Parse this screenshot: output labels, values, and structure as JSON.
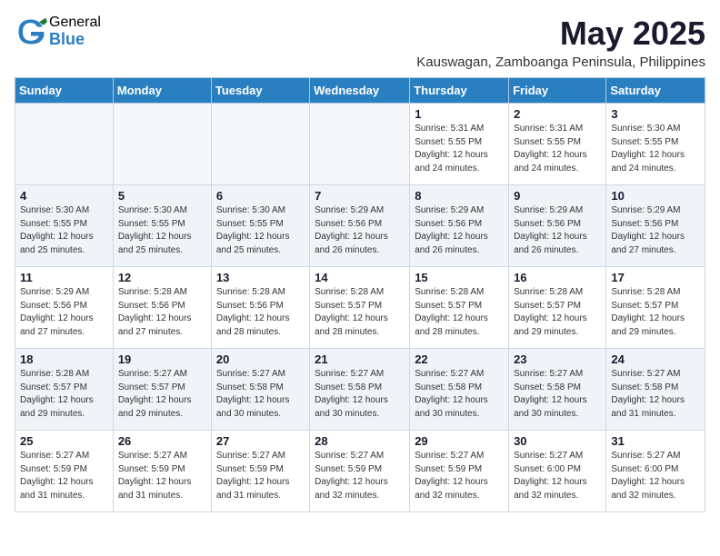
{
  "logo": {
    "general": "General",
    "blue": "Blue"
  },
  "title": "May 2025",
  "location": "Kauswagan, Zamboanga Peninsula, Philippines",
  "weekdays": [
    "Sunday",
    "Monday",
    "Tuesday",
    "Wednesday",
    "Thursday",
    "Friday",
    "Saturday"
  ],
  "weeks": [
    [
      {
        "day": "",
        "info": ""
      },
      {
        "day": "",
        "info": ""
      },
      {
        "day": "",
        "info": ""
      },
      {
        "day": "",
        "info": ""
      },
      {
        "day": "1",
        "info": "Sunrise: 5:31 AM\nSunset: 5:55 PM\nDaylight: 12 hours\nand 24 minutes."
      },
      {
        "day": "2",
        "info": "Sunrise: 5:31 AM\nSunset: 5:55 PM\nDaylight: 12 hours\nand 24 minutes."
      },
      {
        "day": "3",
        "info": "Sunrise: 5:30 AM\nSunset: 5:55 PM\nDaylight: 12 hours\nand 24 minutes."
      }
    ],
    [
      {
        "day": "4",
        "info": "Sunrise: 5:30 AM\nSunset: 5:55 PM\nDaylight: 12 hours\nand 25 minutes."
      },
      {
        "day": "5",
        "info": "Sunrise: 5:30 AM\nSunset: 5:55 PM\nDaylight: 12 hours\nand 25 minutes."
      },
      {
        "day": "6",
        "info": "Sunrise: 5:30 AM\nSunset: 5:55 PM\nDaylight: 12 hours\nand 25 minutes."
      },
      {
        "day": "7",
        "info": "Sunrise: 5:29 AM\nSunset: 5:56 PM\nDaylight: 12 hours\nand 26 minutes."
      },
      {
        "day": "8",
        "info": "Sunrise: 5:29 AM\nSunset: 5:56 PM\nDaylight: 12 hours\nand 26 minutes."
      },
      {
        "day": "9",
        "info": "Sunrise: 5:29 AM\nSunset: 5:56 PM\nDaylight: 12 hours\nand 26 minutes."
      },
      {
        "day": "10",
        "info": "Sunrise: 5:29 AM\nSunset: 5:56 PM\nDaylight: 12 hours\nand 27 minutes."
      }
    ],
    [
      {
        "day": "11",
        "info": "Sunrise: 5:29 AM\nSunset: 5:56 PM\nDaylight: 12 hours\nand 27 minutes."
      },
      {
        "day": "12",
        "info": "Sunrise: 5:28 AM\nSunset: 5:56 PM\nDaylight: 12 hours\nand 27 minutes."
      },
      {
        "day": "13",
        "info": "Sunrise: 5:28 AM\nSunset: 5:56 PM\nDaylight: 12 hours\nand 28 minutes."
      },
      {
        "day": "14",
        "info": "Sunrise: 5:28 AM\nSunset: 5:57 PM\nDaylight: 12 hours\nand 28 minutes."
      },
      {
        "day": "15",
        "info": "Sunrise: 5:28 AM\nSunset: 5:57 PM\nDaylight: 12 hours\nand 28 minutes."
      },
      {
        "day": "16",
        "info": "Sunrise: 5:28 AM\nSunset: 5:57 PM\nDaylight: 12 hours\nand 29 minutes."
      },
      {
        "day": "17",
        "info": "Sunrise: 5:28 AM\nSunset: 5:57 PM\nDaylight: 12 hours\nand 29 minutes."
      }
    ],
    [
      {
        "day": "18",
        "info": "Sunrise: 5:28 AM\nSunset: 5:57 PM\nDaylight: 12 hours\nand 29 minutes."
      },
      {
        "day": "19",
        "info": "Sunrise: 5:27 AM\nSunset: 5:57 PM\nDaylight: 12 hours\nand 29 minutes."
      },
      {
        "day": "20",
        "info": "Sunrise: 5:27 AM\nSunset: 5:58 PM\nDaylight: 12 hours\nand 30 minutes."
      },
      {
        "day": "21",
        "info": "Sunrise: 5:27 AM\nSunset: 5:58 PM\nDaylight: 12 hours\nand 30 minutes."
      },
      {
        "day": "22",
        "info": "Sunrise: 5:27 AM\nSunset: 5:58 PM\nDaylight: 12 hours\nand 30 minutes."
      },
      {
        "day": "23",
        "info": "Sunrise: 5:27 AM\nSunset: 5:58 PM\nDaylight: 12 hours\nand 30 minutes."
      },
      {
        "day": "24",
        "info": "Sunrise: 5:27 AM\nSunset: 5:58 PM\nDaylight: 12 hours\nand 31 minutes."
      }
    ],
    [
      {
        "day": "25",
        "info": "Sunrise: 5:27 AM\nSunset: 5:59 PM\nDaylight: 12 hours\nand 31 minutes."
      },
      {
        "day": "26",
        "info": "Sunrise: 5:27 AM\nSunset: 5:59 PM\nDaylight: 12 hours\nand 31 minutes."
      },
      {
        "day": "27",
        "info": "Sunrise: 5:27 AM\nSunset: 5:59 PM\nDaylight: 12 hours\nand 31 minutes."
      },
      {
        "day": "28",
        "info": "Sunrise: 5:27 AM\nSunset: 5:59 PM\nDaylight: 12 hours\nand 32 minutes."
      },
      {
        "day": "29",
        "info": "Sunrise: 5:27 AM\nSunset: 5:59 PM\nDaylight: 12 hours\nand 32 minutes."
      },
      {
        "day": "30",
        "info": "Sunrise: 5:27 AM\nSunset: 6:00 PM\nDaylight: 12 hours\nand 32 minutes."
      },
      {
        "day": "31",
        "info": "Sunrise: 5:27 AM\nSunset: 6:00 PM\nDaylight: 12 hours\nand 32 minutes."
      }
    ]
  ]
}
